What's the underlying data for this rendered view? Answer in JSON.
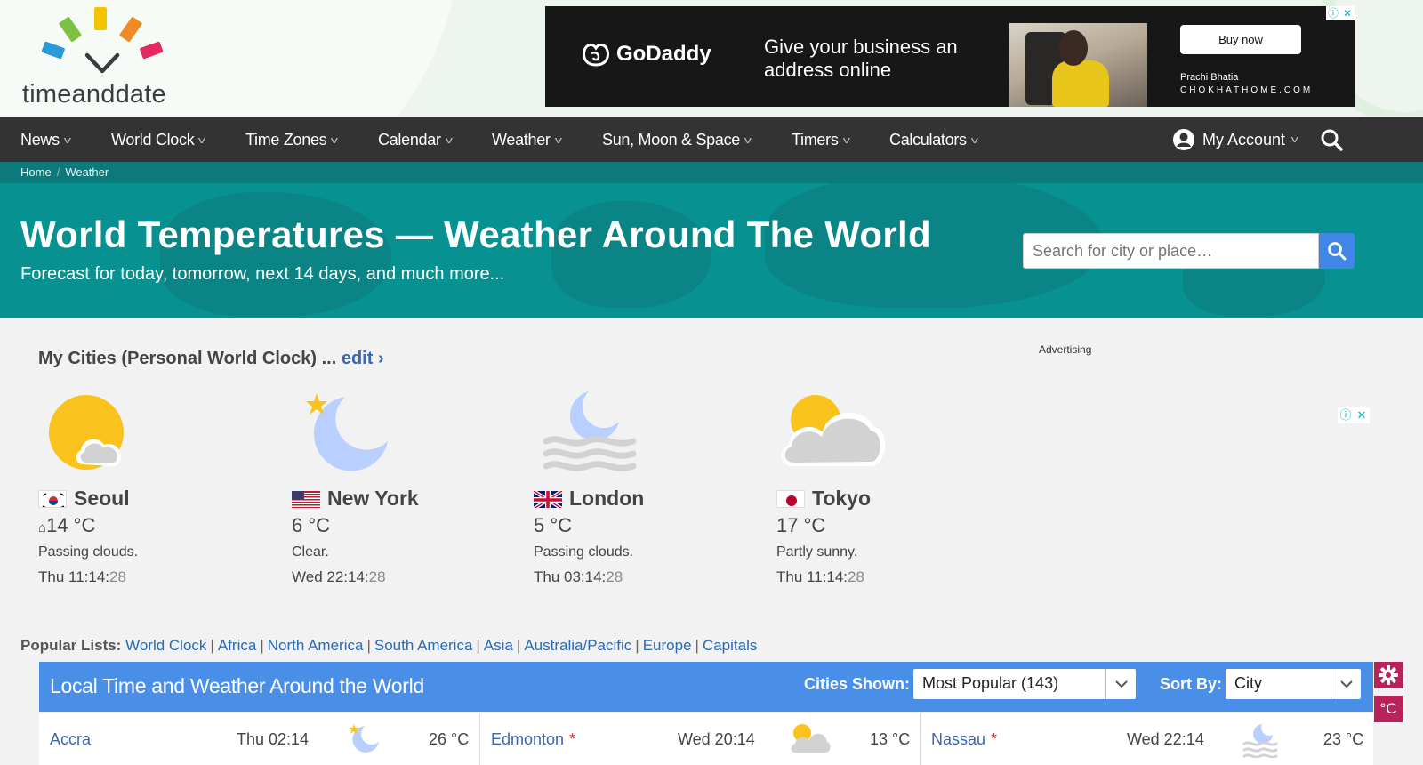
{
  "logo": {
    "text": "timeanddate"
  },
  "ad_banner": {
    "brand": "GoDaddy",
    "message": "Give your business an address online",
    "cta": "Buy now",
    "person_name": "Prachi Bhatia",
    "site": "CHOKHATHOME.COM"
  },
  "nav": {
    "items": [
      "News",
      "World Clock",
      "Time Zones",
      "Calendar",
      "Weather",
      "Sun, Moon & Space",
      "Timers",
      "Calculators"
    ],
    "account": "My Account"
  },
  "breadcrumb": [
    "Home",
    "Weather"
  ],
  "hero": {
    "title": "World Temperatures — Weather Around The World",
    "subtitle": "Forecast for today, tomorrow, next 14 days, and much more...",
    "search_placeholder": "Search for city or place…"
  },
  "my_cities": {
    "heading": "My Cities (Personal World Clock) ...",
    "edit": "edit ›",
    "advertising_label": "Advertising",
    "cities": [
      {
        "name": "Seoul",
        "temp": "14 °C",
        "condition": "Passing clouds.",
        "time": "Thu 11:14:",
        "seconds": "28",
        "icon": "sun-cloud-icon",
        "home": true
      },
      {
        "name": "New York",
        "temp": "6 °C",
        "condition": "Clear.",
        "time": "Wed 22:14:",
        "seconds": "28",
        "icon": "moon-star-icon"
      },
      {
        "name": "London",
        "temp": "5 °C",
        "condition": "Passing clouds.",
        "time": "Thu 03:14:",
        "seconds": "28",
        "icon": "moon-fog-icon"
      },
      {
        "name": "Tokyo",
        "temp": "17 °C",
        "condition": "Partly sunny.",
        "time": "Thu 11:14:",
        "seconds": "28",
        "icon": "cloud-sun-icon"
      }
    ]
  },
  "popular_lists": {
    "label": "Popular Lists:",
    "links": [
      "World Clock",
      "Africa",
      "North America",
      "South America",
      "Asia",
      "Australia/Pacific",
      "Europe",
      "Capitals"
    ]
  },
  "table": {
    "title": "Local Time and Weather Around the World",
    "cities_shown_label": "Cities Shown:",
    "cities_shown_value": "Most Popular (143)",
    "sort_by_label": "Sort By:",
    "sort_by_value": "City",
    "unit_button": "°C",
    "rows": [
      {
        "city": "Accra",
        "dst": "",
        "time": "Thu 02:14",
        "temp": "26 °C",
        "icon": "moon-star-icon"
      },
      {
        "city": "Edmonton",
        "dst": "*",
        "time": "Wed 20:14",
        "temp": "13 °C",
        "icon": "cloud-sun-icon"
      },
      {
        "city": "Nassau",
        "dst": "*",
        "time": "Wed 22:14",
        "temp": "23 °C",
        "icon": "moon-fog-icon"
      }
    ]
  }
}
